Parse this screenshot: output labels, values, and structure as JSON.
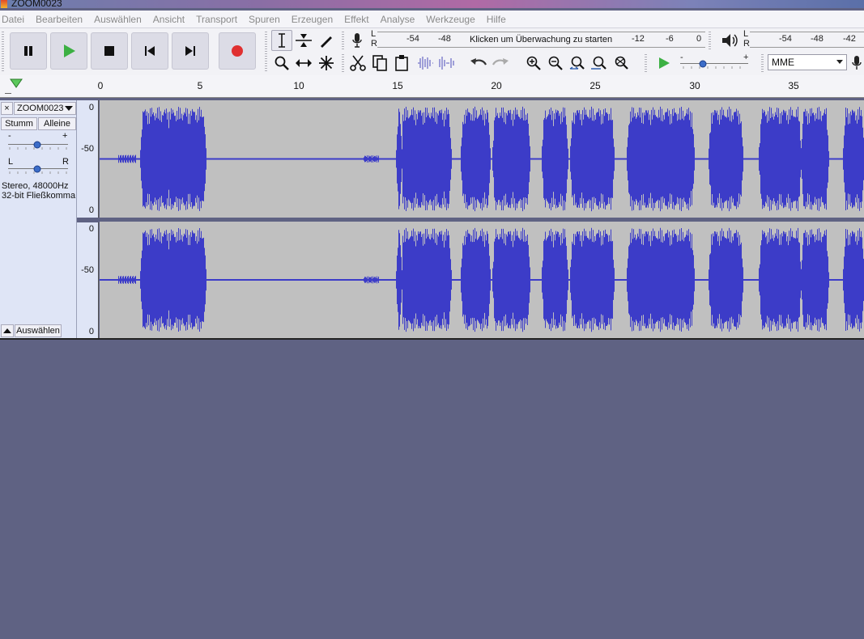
{
  "window": {
    "title": "ZOOM0023"
  },
  "menu": [
    "Datei",
    "Bearbeiten",
    "Auswählen",
    "Ansicht",
    "Transport",
    "Spuren",
    "Erzeugen",
    "Effekt",
    "Analyse",
    "Werkzeuge",
    "Hilfe"
  ],
  "transport": {
    "buttons": [
      "pause-icon",
      "play-icon",
      "stop-icon",
      "skip-start-icon",
      "skip-end-icon",
      "record-icon"
    ],
    "record_color": "#e03030",
    "play_color": "#3cb043"
  },
  "tools": [
    "selection-icon",
    "envelope-icon",
    "draw-icon",
    "zoom-icon",
    "timeshift-icon",
    "multi-tool-icon"
  ],
  "edit": [
    "cut-icon",
    "copy-icon",
    "paste-icon",
    "trim-icon",
    "silence-icon",
    "undo-icon",
    "redo-icon"
  ],
  "zoom_tools": [
    "zoom-in-icon",
    "zoom-out-icon",
    "fit-selection-icon",
    "fit-project-icon",
    "zoom-toggle-icon"
  ],
  "record_meter": {
    "L": "L",
    "R": "R",
    "ticks_left": [
      "-54",
      "-48"
    ],
    "click_text": "Klicken um Überwachung zu starten",
    "ticks_right": [
      "-12",
      "-6",
      "0"
    ]
  },
  "playback_meter": {
    "L": "L",
    "R": "R",
    "ticks": [
      "-54",
      "-48",
      "-42"
    ]
  },
  "play_at_speed": {
    "minus": "-",
    "plus": "+"
  },
  "device": {
    "host": "MME"
  },
  "ruler": {
    "labels": [
      "0",
      "5",
      "10",
      "15",
      "20",
      "25",
      "30",
      "35"
    ]
  },
  "track": {
    "name": "ZOOM0023",
    "close": "×",
    "mute_label": "Stumm",
    "solo_label": "Alleine",
    "gain": {
      "minus": "-",
      "plus": "+"
    },
    "pan": {
      "left": "L",
      "right": "R"
    },
    "info_line1": "Stereo, 48000Hz",
    "info_line2": "32-bit Fließkomma",
    "select_label": "Auswählen",
    "scale_top": [
      "0",
      "-50",
      "0"
    ],
    "scale_bottom": [
      "0",
      "-50",
      "0"
    ],
    "waveform_color": "#3c3cc8"
  }
}
